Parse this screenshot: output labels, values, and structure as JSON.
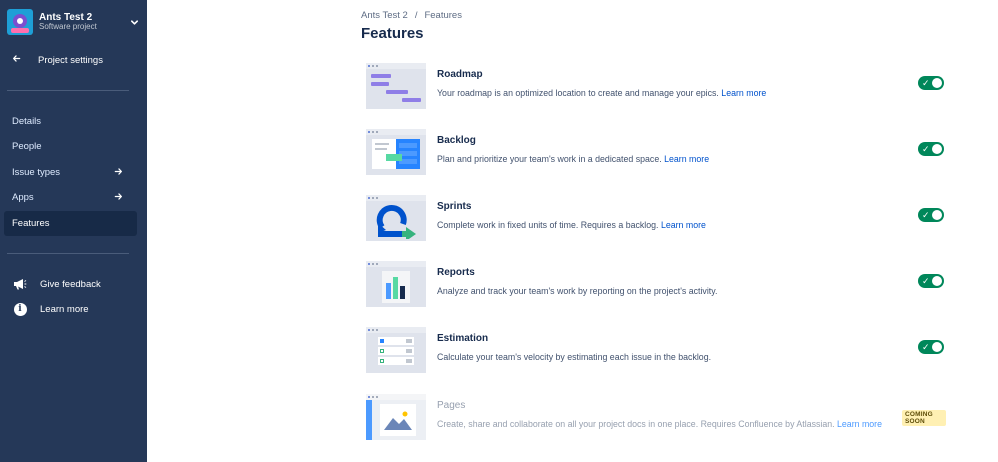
{
  "sidebar": {
    "project_name": "Ants Test 2",
    "project_type": "Software project",
    "back_label": "Project settings",
    "nav": [
      {
        "label": "Details",
        "has_chevron": false
      },
      {
        "label": "People",
        "has_chevron": false
      },
      {
        "label": "Issue types",
        "has_chevron": true
      },
      {
        "label": "Apps",
        "has_chevron": true
      },
      {
        "label": "Features",
        "has_chevron": false,
        "active": true
      }
    ],
    "utility": [
      {
        "label": "Give feedback",
        "icon": "megaphone-icon"
      },
      {
        "label": "Learn more",
        "icon": "info-icon"
      }
    ]
  },
  "breadcrumb": {
    "project": "Ants Test 2",
    "current": "Features"
  },
  "page_title": "Features",
  "features": [
    {
      "title": "Roadmap",
      "description": "Your roadmap is an optimized location to create and manage your epics.",
      "link": "Learn more",
      "enabled": true
    },
    {
      "title": "Backlog",
      "description": "Plan and prioritize your team's work in a dedicated space.",
      "link": "Learn more",
      "enabled": true
    },
    {
      "title": "Sprints",
      "description": "Complete work in fixed units of time. Requires a backlog.",
      "link": "Learn more",
      "enabled": true
    },
    {
      "title": "Reports",
      "description": "Analyze and track your team's work by reporting on the project's activity.",
      "link": "",
      "enabled": true
    },
    {
      "title": "Estimation",
      "description": "Calculate your team's velocity by estimating each issue in the backlog.",
      "link": "",
      "enabled": true
    },
    {
      "title": "Pages",
      "description": "Create, share and collaborate on all your project docs in one place. Requires Confluence by Atlassian.",
      "link": "Learn more",
      "enabled": false,
      "badge": "COMING SOON"
    }
  ],
  "colors": {
    "sidebar": "#253858",
    "sidebar_active": "#172a47",
    "toggle_on": "#00875a",
    "link": "#0052cc",
    "badge_bg": "#fff0b3"
  }
}
